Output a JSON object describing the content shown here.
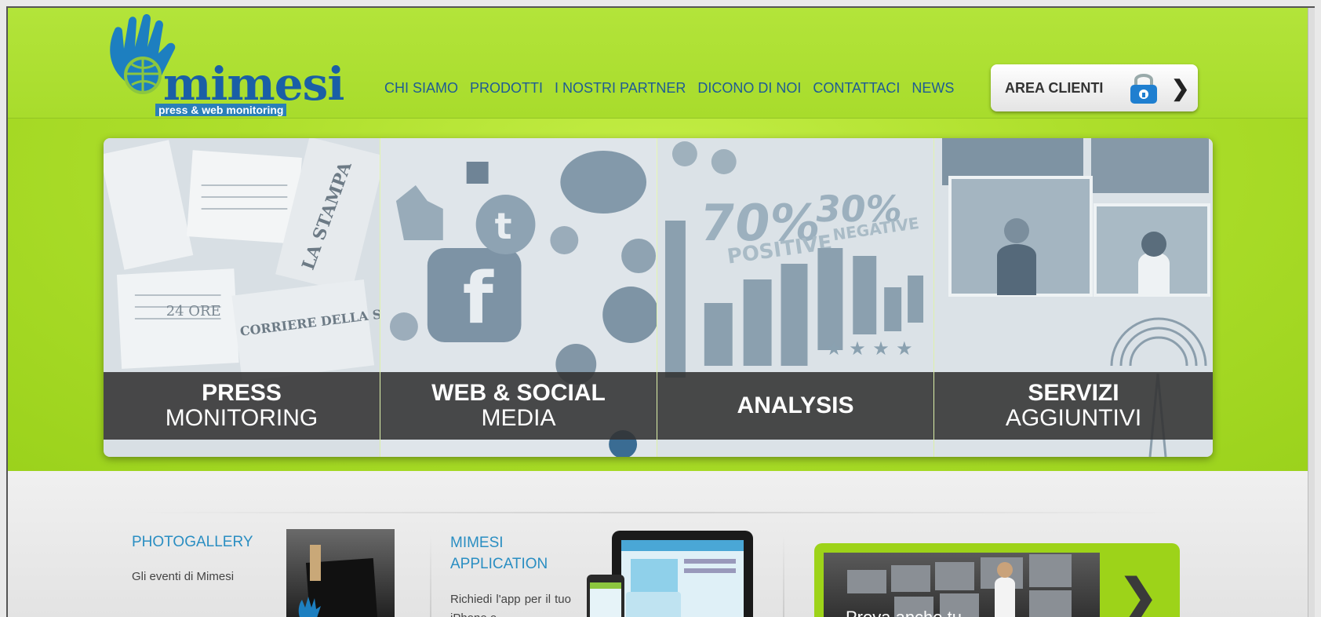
{
  "logo": {
    "name": "mimesi",
    "tagline": "press & web monitoring"
  },
  "nav": {
    "items": [
      "CHI SIAMO",
      "PRODOTTI",
      "I NOSTRI PARTNER",
      "DICONO DI NOI",
      "CONTATTACI",
      "NEWS"
    ]
  },
  "area_clienti": {
    "label": "AREA CLIENTI",
    "icon": "lock-icon"
  },
  "banner": {
    "panels": [
      {
        "line1": "PRESS",
        "line2": "MONITORING"
      },
      {
        "line1": "WEB & SOCIAL",
        "line2": "MEDIA"
      },
      {
        "line1": "ANALYSIS",
        "line2": ""
      },
      {
        "line1": "SERVIZI",
        "line2": "AGGIUNTIVI"
      }
    ],
    "analysis_overlay": {
      "pct1": "70%",
      "pct2": "30%",
      "lbl1": "POSITIVE",
      "lbl2": "NEGATIVE"
    },
    "press_overlay": {
      "n1": "LA STAMPA",
      "n2": "CORRIERE DELLA SERA",
      "n3": "24 ORE"
    }
  },
  "photogallery": {
    "title": "PHOTOGALLERY",
    "subtitle": "Gli eventi di Mimesi"
  },
  "app": {
    "title_line1": "MIMESI",
    "title_line2": "APPLICATION",
    "text": "Richiedi l'app per il tuo iPhone e"
  },
  "promo": {
    "text": "Prova anche tu"
  },
  "colors": {
    "header_green": "#a8dc2c",
    "nav_blue": "#1e5b94",
    "accent_blue": "#2a8ec2"
  }
}
